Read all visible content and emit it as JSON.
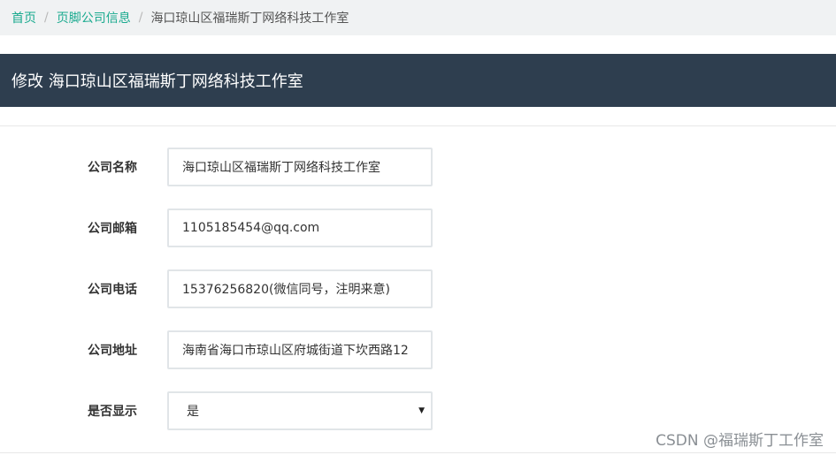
{
  "breadcrumb": {
    "home": "首页",
    "section": "页脚公司信息",
    "current": "海口琼山区福瑞斯丁网络科技工作室"
  },
  "panel": {
    "title": "修改 海口琼山区福瑞斯丁网络科技工作室"
  },
  "form": {
    "company_name": {
      "label": "公司名称",
      "value": "海口琼山区福瑞斯丁网络科技工作室"
    },
    "company_email": {
      "label": "公司邮箱",
      "value": "1105185454@qq.com"
    },
    "company_phone": {
      "label": "公司电话",
      "value": "15376256820(微信同号，注明来意)"
    },
    "company_address": {
      "label": "公司地址",
      "value": "海南省海口市琼山区府城街道下坎西路12"
    },
    "display": {
      "label": "是否显示",
      "selected": "是"
    }
  },
  "watermark": "CSDN @福瑞斯丁工作室",
  "colors": {
    "link": "#1aaa8f",
    "header_bg": "#2e3e4f",
    "breadcrumb_bg": "#f0f2f3"
  }
}
